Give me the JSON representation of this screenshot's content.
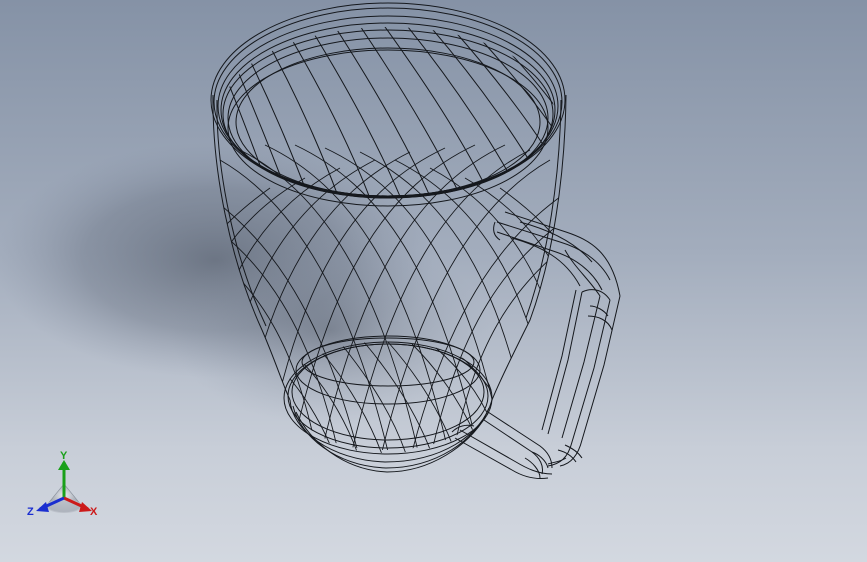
{
  "viewport": {
    "model": "mug",
    "display_mode": "wireframe",
    "background_gradient": [
      "#8592a6",
      "#d3d8e0"
    ],
    "wire_color": "#15181d"
  },
  "triad": {
    "x_label": "X",
    "y_label": "Y",
    "z_label": "Z",
    "x_color": "#cc1a1a",
    "y_color": "#1aa01a",
    "z_color": "#1a2ed0"
  }
}
